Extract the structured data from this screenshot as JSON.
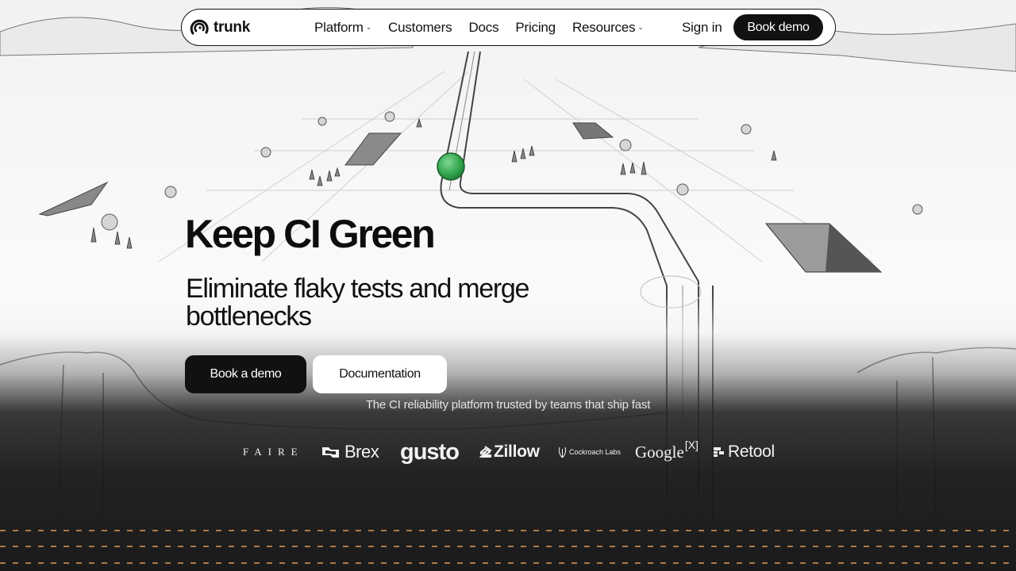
{
  "nav": {
    "brand": "trunk",
    "links": [
      {
        "label": "Platform",
        "has_menu": true
      },
      {
        "label": "Customers",
        "has_menu": false
      },
      {
        "label": "Docs",
        "has_menu": false
      },
      {
        "label": "Pricing",
        "has_menu": false
      },
      {
        "label": "Resources",
        "has_menu": true
      }
    ],
    "sign_in": "Sign in",
    "book_demo": "Book demo"
  },
  "hero": {
    "title": "Keep CI Green",
    "subtitle": "Eliminate flaky tests and merge bottlenecks",
    "primary_cta": "Book a demo",
    "secondary_cta": "Documentation"
  },
  "trusted_by": {
    "tagline": "The CI reliability platform trusted by teams that ship fast",
    "logos": {
      "faire": "FAIRE",
      "brex": "Brex",
      "gusto": "gusto",
      "zillow": "Zillow",
      "cockroach": "Cockroach Labs",
      "google": "Google",
      "google_sup": "[X]",
      "retool": "Retool"
    }
  },
  "colors": {
    "accent_green": "#3fae5a",
    "dark": "#111111",
    "dash_orange": "#c98a4d"
  }
}
